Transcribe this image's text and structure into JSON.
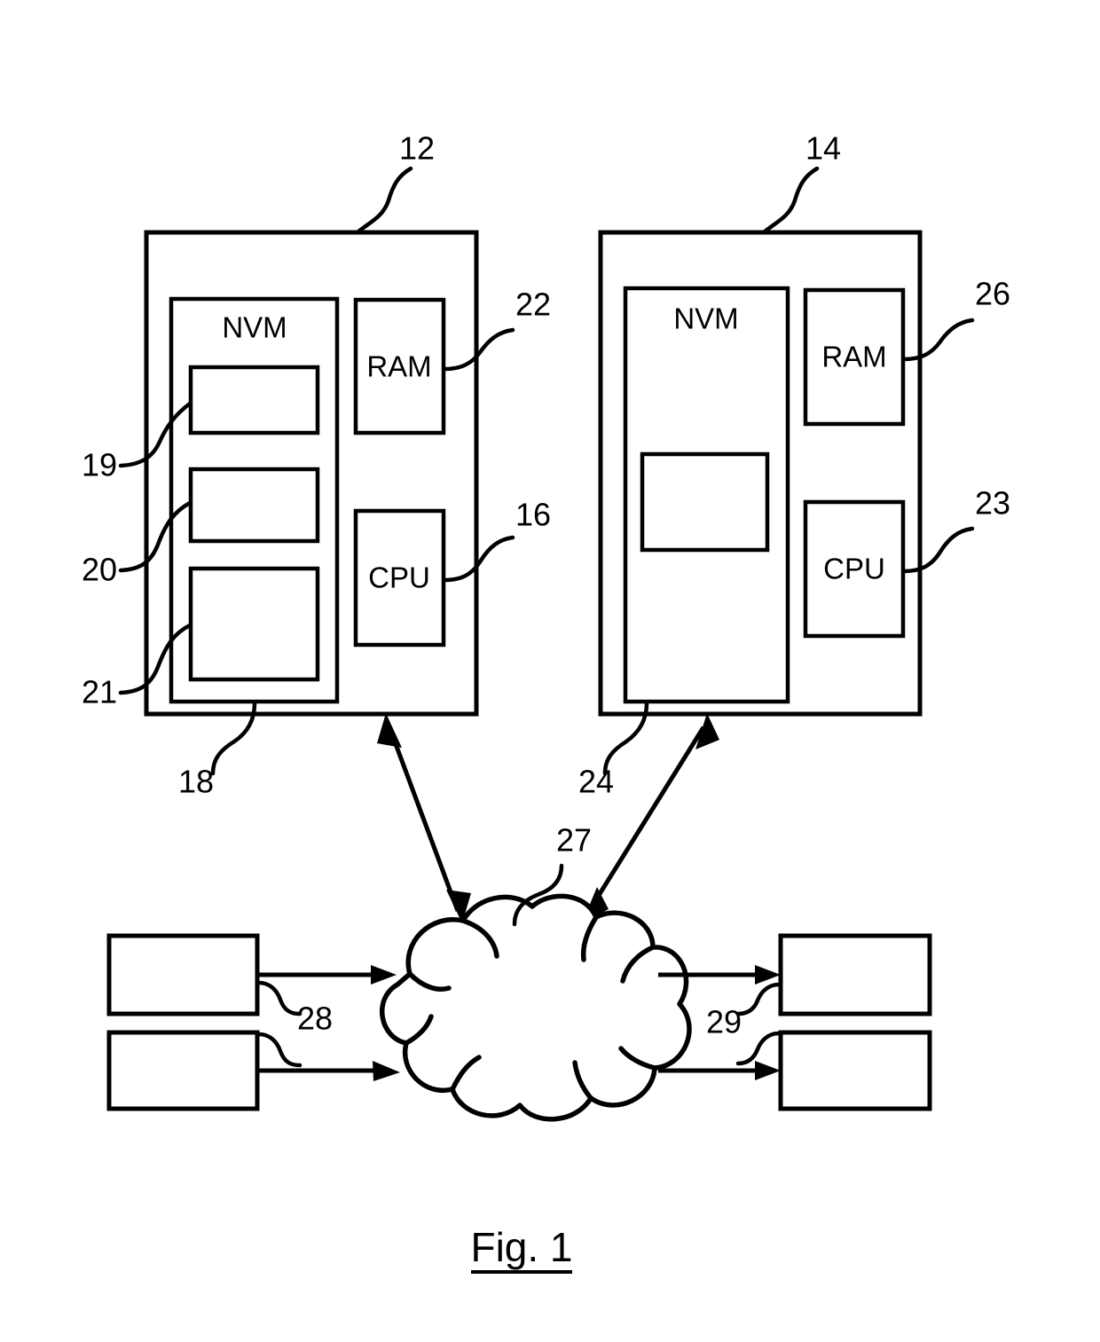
{
  "figure": {
    "caption": "Fig. 1",
    "underline": true
  },
  "components": {
    "device_left": {
      "ref": "12",
      "nvm_label": "NVM",
      "nvm_ref": "18",
      "ram_label": "RAM",
      "ram_ref": "22",
      "cpu_label": "CPU",
      "cpu_ref": "16",
      "nvm_blocks": [
        {
          "ref": "19"
        },
        {
          "ref": "20"
        },
        {
          "ref": "21"
        }
      ]
    },
    "device_right": {
      "ref": "14",
      "nvm_label": "NVM",
      "nvm_ref": "24",
      "ram_label": "RAM",
      "ram_ref": "26",
      "cpu_label": "CPU",
      "cpu_ref": "23",
      "nvm_blocks": [
        {
          "ref": ""
        }
      ]
    },
    "network": {
      "ref": "27",
      "shape": "cloud-icon"
    },
    "left_nodes": {
      "ref": "28",
      "count": 2
    },
    "right_nodes": {
      "ref": "29",
      "count": 2
    }
  },
  "connections": {
    "device_left_to_network": "bidirectional",
    "device_right_to_network": "bidirectional",
    "left_node_1_to_network": "unidirectional",
    "left_node_2_to_network": "unidirectional",
    "network_to_right_node_1": "unidirectional",
    "network_to_right_node_2": "unidirectional"
  },
  "colors": {
    "stroke": "#000000",
    "background": "#ffffff"
  }
}
